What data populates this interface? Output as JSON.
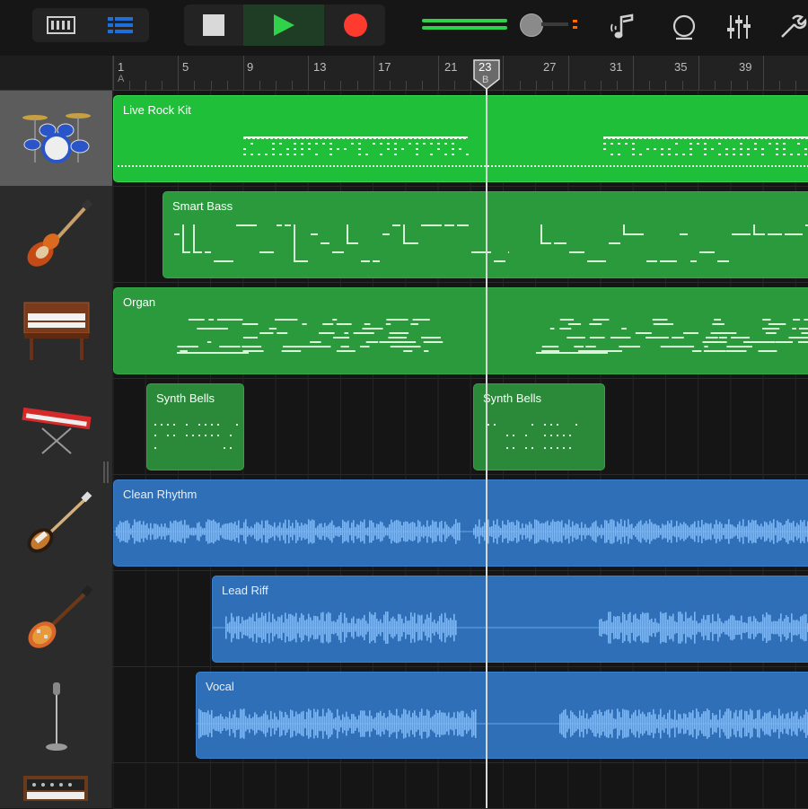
{
  "toolbar": {
    "view_buttons": [
      "tracks-view-icon",
      "list-view-icon"
    ],
    "transport": [
      "stop-icon",
      "play-icon",
      "record-icon"
    ],
    "tools": [
      "instrument-note-icon",
      "loop-icon",
      "mixer-icon",
      "settings-wrench-icon"
    ],
    "colors": {
      "play": "#2fd24a",
      "record": "#ff3b30",
      "accent": "#1e6fd9"
    }
  },
  "ruler": {
    "bars": [
      "1",
      "5",
      "9",
      "13",
      "17",
      "21",
      "23",
      "27",
      "31",
      "35",
      "39"
    ],
    "section_start": "A",
    "section_playhead": "B"
  },
  "tracks": [
    {
      "name": "Live Rock Kit",
      "instrument": "drum-kit-icon",
      "regions": [
        {
          "label": "Live Rock Kit"
        }
      ]
    },
    {
      "name": "Smart Bass",
      "instrument": "bass-guitar-icon",
      "regions": [
        {
          "label": "Smart Bass"
        }
      ]
    },
    {
      "name": "Organ",
      "instrument": "organ-icon",
      "regions": [
        {
          "label": "Organ"
        }
      ]
    },
    {
      "name": "Synth Bells",
      "instrument": "keyboard-synth-icon",
      "regions": [
        {
          "label": "Synth Bells"
        },
        {
          "label": "Synth Bells"
        }
      ]
    },
    {
      "name": "Clean Rhythm",
      "instrument": "electric-guitar-icon",
      "regions": [
        {
          "label": "Clean Rhythm"
        }
      ]
    },
    {
      "name": "Lead Riff",
      "instrument": "les-paul-guitar-icon",
      "regions": [
        {
          "label": "Lead Riff"
        }
      ]
    },
    {
      "name": "Vocal",
      "instrument": "microphone-icon",
      "regions": [
        {
          "label": "Vocal"
        }
      ]
    },
    {
      "name": "",
      "instrument": "analog-synth-icon",
      "regions": []
    }
  ]
}
